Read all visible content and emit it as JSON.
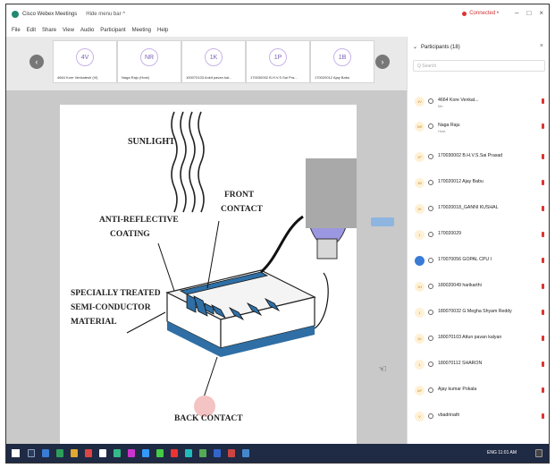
{
  "window": {
    "title": "Cisco Webex Meetings",
    "hide_menu": "Hide menu bar ^",
    "status": "Connected •",
    "controls": [
      "–",
      "□",
      "×"
    ]
  },
  "menu": [
    "File",
    "Edit",
    "Share",
    "View",
    "Audio",
    "Participant",
    "Meeting",
    "Help"
  ],
  "thumbnails": [
    {
      "initials": "4V",
      "name": "4664 Kore Venkatesh (Vi)"
    },
    {
      "initials": "NR",
      "name": "Naga Raju (Host)"
    },
    {
      "initials": "1K",
      "name": "100070103 Ankit pavan kal..."
    },
    {
      "initials": "1P",
      "name": "170030002 B.H.V.S.Sai Pra..."
    },
    {
      "initials": "1B",
      "name": "170020012 Ajay Babu"
    }
  ],
  "slide": {
    "labels": {
      "sunlight": "SUNLIGHT",
      "front_contact_1": "FRONT",
      "front_contact_2": "CONTACT",
      "anti_1": "ANTI-REFLECTIVE",
      "anti_2": "COATING",
      "semi_1": "SPECIALLY TREATED",
      "semi_2": "SEMI-CONDUCTOR",
      "semi_3": "MATERIAL",
      "back_contact": "BACK CONTACT"
    }
  },
  "participants": {
    "header": "Participants (18)",
    "search_placeholder": "Q  Search",
    "items": [
      {
        "avatar": "4V",
        "name": "4664 Kore Venkat...",
        "sub": "Me"
      },
      {
        "avatar": "NR",
        "name": "Naga Raju",
        "sub": "Host"
      },
      {
        "avatar": "1P",
        "name": "170030002 B.H.V.S.Sai Prasad",
        "sub": ""
      },
      {
        "avatar": "1B",
        "name": "170020012 Ajay Babu",
        "sub": ""
      },
      {
        "avatar": "1K",
        "name": "170020018_GANNI KUSHAL",
        "sub": ""
      },
      {
        "avatar": "1",
        "name": "170020029",
        "sub": ""
      },
      {
        "avatar": "",
        "name": "170070056 GOPAL CPU I",
        "sub": ""
      },
      {
        "avatar": "1H",
        "name": "180020049 harikarthi",
        "sub": ""
      },
      {
        "avatar": "1",
        "name": "180070032 G Megha Shyam Reddy",
        "sub": ""
      },
      {
        "avatar": "1K",
        "name": "180070103 Attun pavan kalyan",
        "sub": ""
      },
      {
        "avatar": "1",
        "name": "180070112 SHARON",
        "sub": ""
      },
      {
        "avatar": "AP",
        "name": "Ajay kumar Pokala",
        "sub": ""
      },
      {
        "avatar": "V",
        "name": "vbadrinath",
        "sub": ""
      }
    ]
  },
  "taskbar": {
    "tray": "ENG  11:01 AM"
  },
  "colors": {
    "accent": "#d33333",
    "avatar_bg": "#fff1d6",
    "taskbar": "#1f2a44",
    "cell_blue": "#2f6fa5"
  }
}
